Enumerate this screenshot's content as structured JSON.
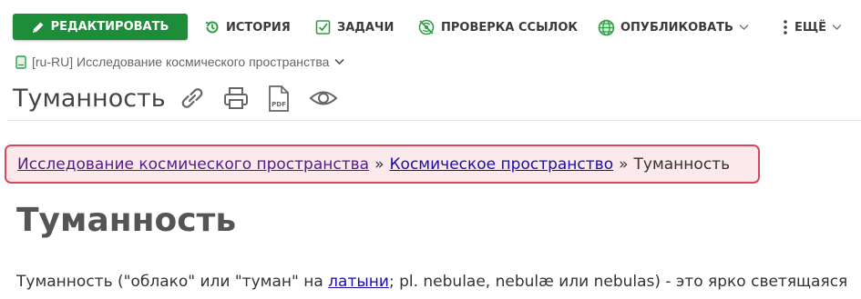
{
  "toolbar": {
    "edit_label": "РЕДАКТИРОВАТЬ",
    "history_label": "ИСТОРИЯ",
    "tasks_label": "ЗАДАЧИ",
    "links_label": "ПРОВЕРКА ССЫЛОК",
    "publish_label": "ОПУБЛИКОВАТЬ",
    "more_label": "ЕЩЁ"
  },
  "space": {
    "label": "[ru-RU] Исследование космического пространства"
  },
  "page": {
    "title": "Туманность",
    "icons": [
      "link-icon",
      "print-icon",
      "pdf-icon",
      "eye-icon"
    ],
    "pdf_text": "PDF"
  },
  "breadcrumb": {
    "items": [
      {
        "label": "Исследование космического пространства",
        "link": true
      },
      {
        "label": "Космическое пространство",
        "link": true
      },
      {
        "label": "Туманность",
        "link": false
      }
    ],
    "separator": "»"
  },
  "content": {
    "heading": "Туманность",
    "para_before": "Туманность (\"облако\" или \"туман\" на ",
    "para_link": "латыни",
    "para_after": "; pl. nebulae, nebulæ или nebulas) - это ярко светящаяся"
  },
  "colors": {
    "accent": "#1e8d3a",
    "breadcrumb_border": "#d9475b",
    "breadcrumb_bg": "#fbe9ec"
  }
}
